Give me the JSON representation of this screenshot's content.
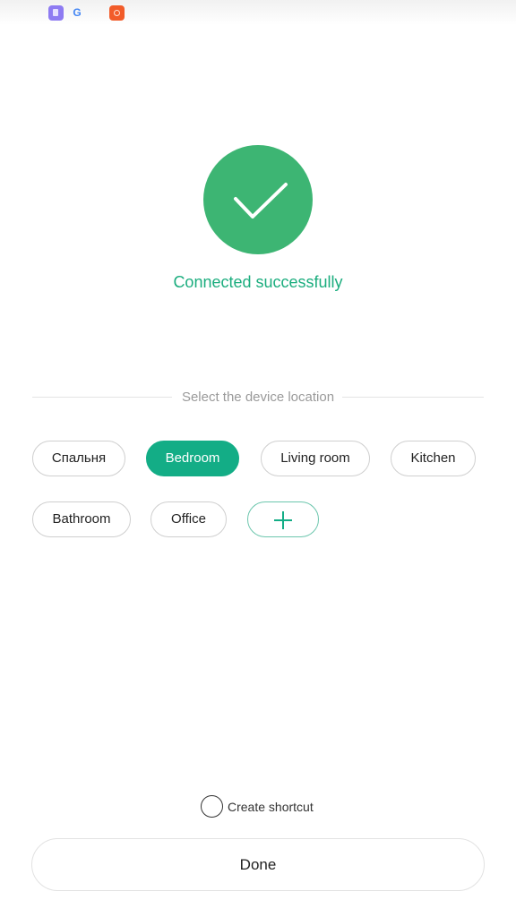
{
  "status_bar": {
    "icons": [
      "app-icon",
      "google-icon",
      "mi-home-icon"
    ],
    "google_glyph": "G"
  },
  "result": {
    "icon": "checkmark-icon",
    "message": "Connected successfully",
    "accent_color": "#3db573"
  },
  "location": {
    "label": "Select the device location",
    "selected": "Bedroom",
    "options": [
      "Спальня",
      "Bedroom",
      "Living room",
      "Kitchen",
      "Bathroom",
      "Office"
    ],
    "add_icon": "plus-icon"
  },
  "shortcut": {
    "label": "Create shortcut",
    "checked": false
  },
  "footer": {
    "done_label": "Done"
  }
}
